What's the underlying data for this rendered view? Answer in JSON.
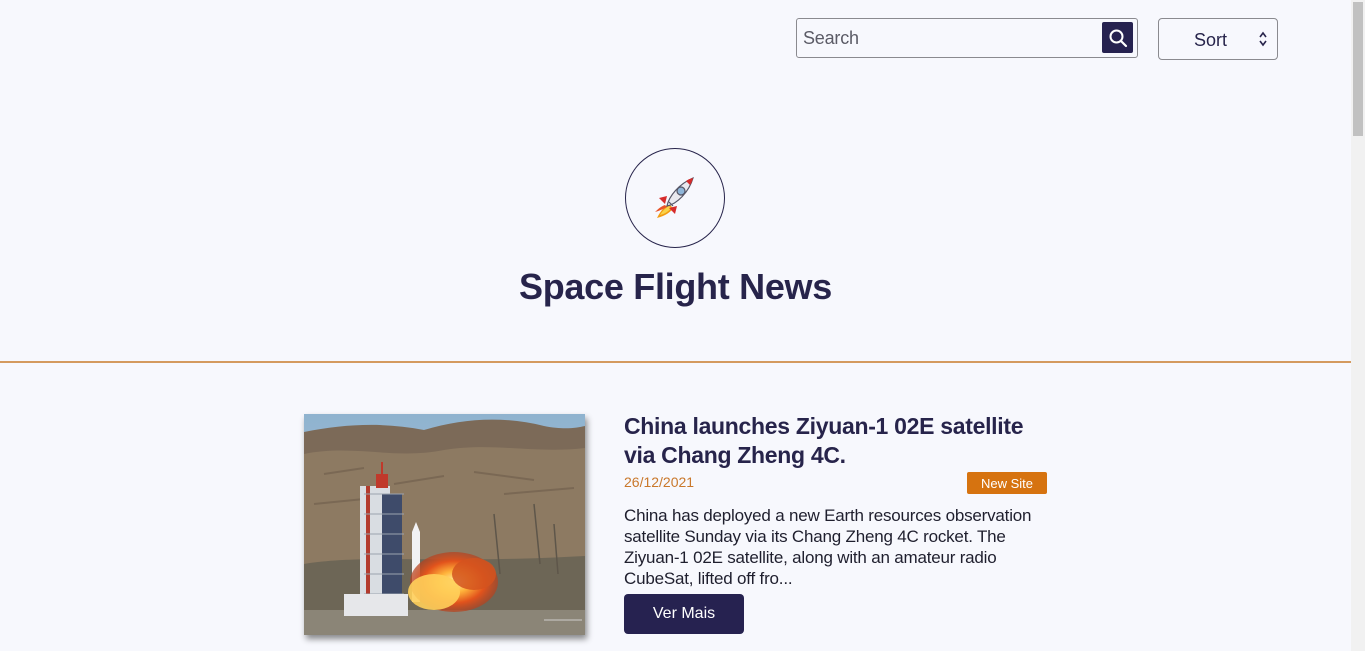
{
  "search": {
    "placeholder": "Search",
    "icon": "search-icon"
  },
  "sort": {
    "label": "Sort",
    "icon": "chevron-up-down-icon"
  },
  "header": {
    "logo_icon": "rocket-icon",
    "title": "Space Flight News"
  },
  "colors": {
    "primary": "#262250",
    "accent": "#d67310",
    "divider": "#d49a5f",
    "background": "#f7f8fd"
  },
  "articles": [
    {
      "title": "China launches Ziyuan-1 02E satellite via Chang Zheng 4C.",
      "date": "26/12/2021",
      "badge": "New Site",
      "summary": "China has deployed a new Earth resources observation satellite Sunday via its Chang Zheng 4C rocket. The Ziyuan-1 02E satellite, along with an amateur radio CubeSat, lifted off fro...",
      "button_label": "Ver Mais"
    }
  ]
}
